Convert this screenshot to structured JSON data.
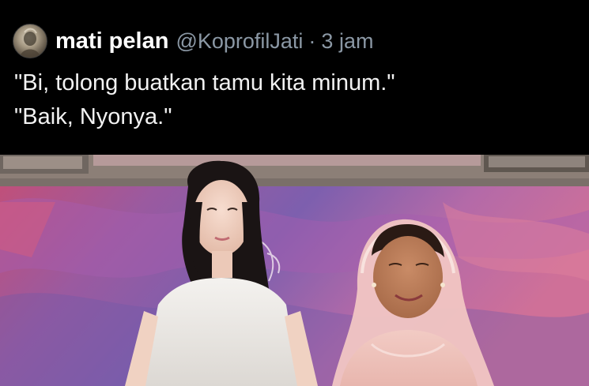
{
  "tweet": {
    "avatar_icon": "user-avatar-icon",
    "display_name": "mati pelan",
    "handle": "@KoprofilJati",
    "separator": "·",
    "time": "3 jam",
    "text_lines": [
      "\"Bi, tolong buatkan tamu kita minum.\"",
      "\"Baik, Nyonya.\""
    ]
  },
  "colors": {
    "background": "#000000",
    "name": "#ffffff",
    "muted": "#8b98a5",
    "text": "#f2f2f2",
    "wall_purple": "#8a5fa7",
    "wall_pink": "#d96b8f"
  }
}
